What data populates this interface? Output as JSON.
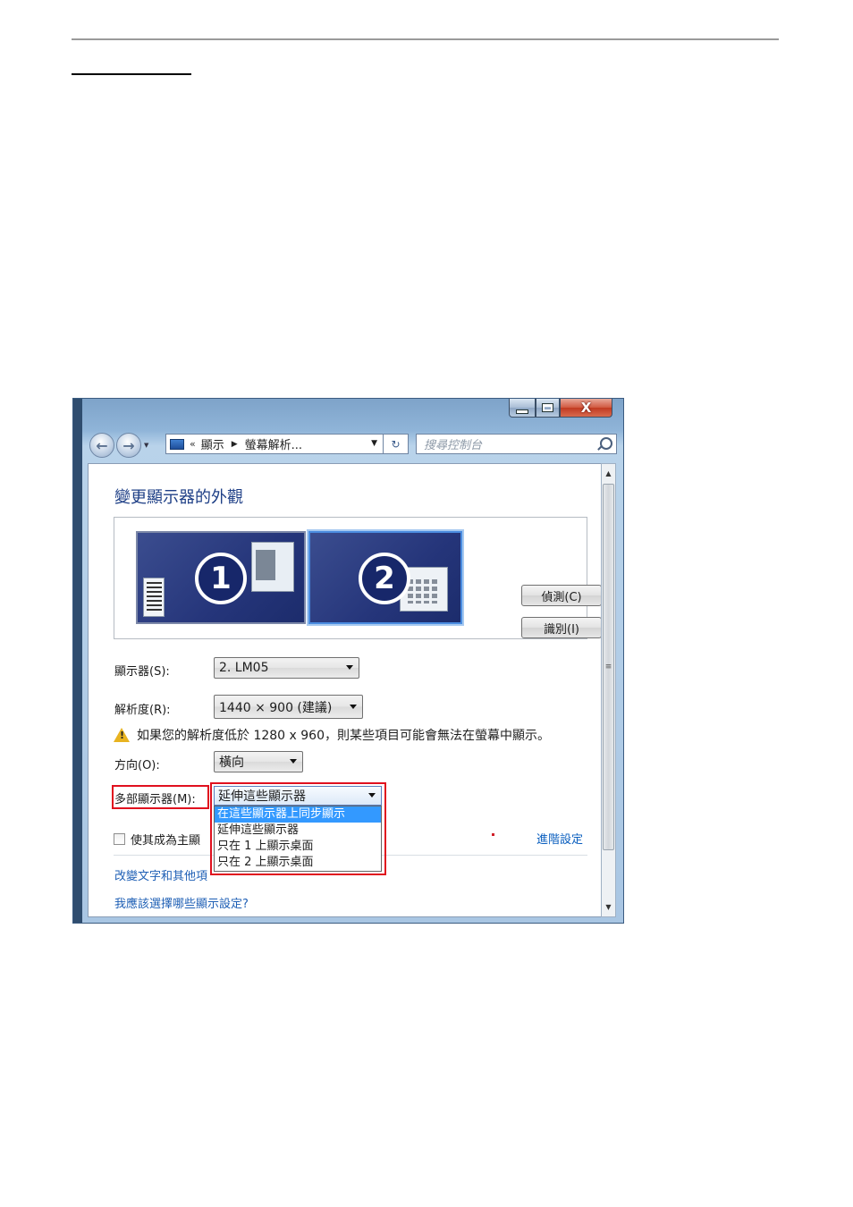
{
  "window": {
    "address": {
      "prefix": "«",
      "crumb1": "顯示",
      "crumb2": "螢幕解析...",
      "search_placeholder": "搜尋控制台"
    },
    "caption": {
      "close_glyph": "X"
    }
  },
  "page": {
    "title": "變更顯示器的外觀",
    "monitor1_number": "1",
    "monitor2_number": "2",
    "detect_button": "偵測(C)",
    "identify_button": "識別(I)",
    "display_label": "顯示器(S):",
    "display_value": "2. LM05",
    "resolution_label": "解析度(R):",
    "resolution_value": "1440 × 900 (建議)",
    "warning_text": "如果您的解析度低於 1280 x 960，則某些項目可能會無法在螢幕中顯示。",
    "orientation_label": "方向(O):",
    "orientation_value": "橫向",
    "multi_label": "多部顯示器(M):",
    "multi_value": "延伸這些顯示器",
    "multi_options": [
      "在這些顯示器上同步顯示",
      "延伸這些顯示器",
      "只在 1 上顯示桌面",
      "只在 2 上顯示桌面"
    ],
    "primary_checkbox_label": "使其成為主顯",
    "advanced_link": "進階設定",
    "link_text_size": "改變文字和其他項",
    "link_which_settings": "我應該選擇哪些顯示設定?"
  }
}
